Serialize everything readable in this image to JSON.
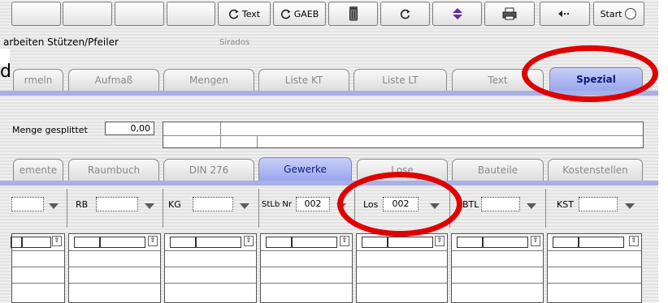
{
  "toolbar": {
    "text_label": "Text",
    "gaeb_label": "GAEB",
    "start_label": "Start",
    "icons": [
      "refresh-icon",
      "refresh-icon",
      "trash-icon",
      "refresh-icon",
      "sort-icon",
      "printer-icon",
      "back-icon",
      "radio-icon"
    ]
  },
  "window": {
    "title": "arbeiten Stützen/Pfeiler",
    "app_name": "Sirados",
    "stray_text": "d"
  },
  "tabs_top": [
    "rmeln",
    "Aufmaß",
    "Mengen",
    "Liste KT",
    "Liste LT",
    "Text",
    "Spezial"
  ],
  "active_top_tab": "Spezial",
  "menge": {
    "label": "Menge gesplittet",
    "value": "0,00"
  },
  "tabs_mid": [
    "emente",
    "Raumbuch",
    "DIN 276",
    "Gewerke",
    "Lose",
    "Bauteile",
    "Kostenstellen"
  ],
  "active_mid_tab": "Gewerke",
  "filters": [
    {
      "label": "",
      "value": ""
    },
    {
      "label": "RB",
      "value": ""
    },
    {
      "label": "KG",
      "value": ""
    },
    {
      "label": "StLb Nr",
      "value": "002"
    },
    {
      "label": "Los",
      "value": "002"
    },
    {
      "label": "BTL",
      "value": ""
    },
    {
      "label": "KST",
      "value": ""
    }
  ],
  "colors": {
    "highlight": "#e00000",
    "active_tab": "#9aa6ee",
    "band": "#a8b0e8"
  }
}
